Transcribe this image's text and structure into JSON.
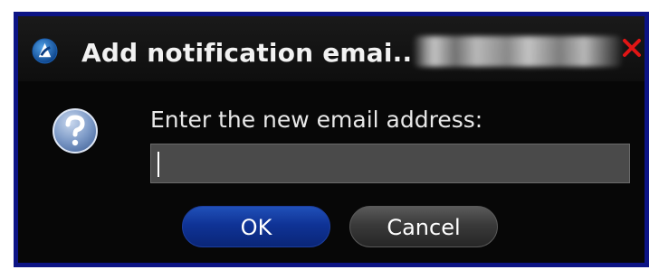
{
  "dialog": {
    "title": "Add notification emai..",
    "prompt": "Enter the new email address:",
    "input_value": "",
    "ok_label": "OK",
    "cancel_label": "Cancel"
  },
  "icons": {
    "app": "app-logo-icon",
    "question": "question-icon",
    "close": "close-icon"
  },
  "colors": {
    "dialog_border": "#0c1485",
    "background": "#070707",
    "ok_button": "#0f3396",
    "cancel_button": "#3a3a3a",
    "close_x": "#e01515",
    "input_bg": "#4a4a4a"
  }
}
